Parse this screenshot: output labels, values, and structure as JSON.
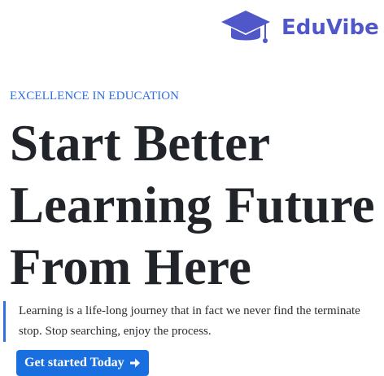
{
  "brand": {
    "name": "EduVibe",
    "logo_icon": "graduation-cap-icon",
    "color": "#4f57c9"
  },
  "hero": {
    "eyebrow": "EXCELLENCE IN EDUCATION",
    "headline_lines": [
      "Start Better",
      "Learning Future",
      "From Here"
    ],
    "description": "Learning is a life-long journey that in fact we never find the terminate stop. Stop searching, enjoy the process.",
    "cta_label": "Get started Today",
    "cta_icon": "arrow-right-icon",
    "accent_color": "#2f6fe0",
    "button_color": "#1a6fe0"
  }
}
